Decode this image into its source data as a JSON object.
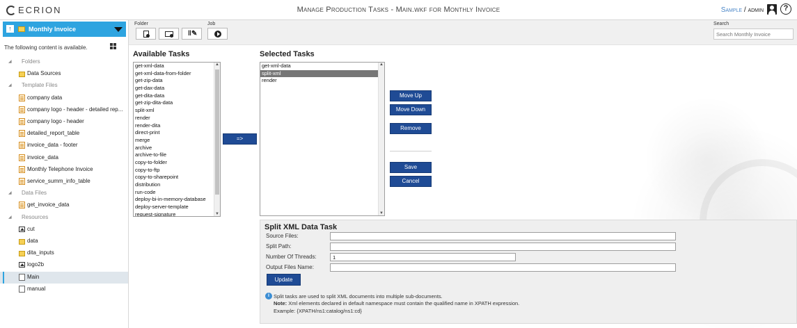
{
  "header": {
    "logo": "ECRION",
    "title": "Manage Production Tasks - Main.wkf for Monthly Invoice",
    "user_sample": "Sample",
    "user_separator": "/",
    "user_name": "admin",
    "help": "?"
  },
  "sidebar": {
    "project": "Monthly Invoice",
    "availability": "The following content is available.",
    "tree": [
      {
        "type": "section",
        "label": "Folders"
      },
      {
        "type": "folder",
        "label": "Data Sources"
      },
      {
        "type": "section",
        "label": "Template Files"
      },
      {
        "type": "template",
        "label": "company data"
      },
      {
        "type": "template",
        "label": "company logo - header - detailed rep..."
      },
      {
        "type": "template",
        "label": "company logo - header"
      },
      {
        "type": "template",
        "label": "detailed_report_table"
      },
      {
        "type": "template",
        "label": "invoice_data - footer"
      },
      {
        "type": "template",
        "label": "invoice_data"
      },
      {
        "type": "template",
        "label": "Monthly Telephone Invoice"
      },
      {
        "type": "template",
        "label": "service_summ_info_table"
      },
      {
        "type": "section",
        "label": "Data Files"
      },
      {
        "type": "template",
        "label": "get_invoice_data"
      },
      {
        "type": "section",
        "label": "Resources"
      },
      {
        "type": "image",
        "label": "cut"
      },
      {
        "type": "folder",
        "label": "data"
      },
      {
        "type": "folder",
        "label": "dita_inputs"
      },
      {
        "type": "image",
        "label": "logo2b"
      },
      {
        "type": "workflow",
        "label": "Main",
        "active": true
      },
      {
        "type": "doc",
        "label": "manual"
      }
    ]
  },
  "toolbar": {
    "folder_label": "Folder",
    "job_label": "Job",
    "search_label": "Search",
    "search_placeholder": "Search Monthly Invoice",
    "icons": [
      "new-file-icon",
      "folder-settings-icon",
      "tools-icon",
      "play-icon"
    ]
  },
  "available": {
    "heading": "Available Tasks",
    "items": [
      "get-xml-data",
      "get-xml-data-from-folder",
      "get-zip-data",
      "get-dax-data",
      "get-dita-data",
      "get-zip-dita-data",
      "split-xml",
      "render",
      "render-dita",
      "direct-print",
      "merge",
      "archive",
      "archive-to-file",
      "copy-to-folder",
      "copy-to-ftp",
      "copy-to-sharepoint",
      "distribution",
      "run-code",
      "deploy-bi-in-memory-database",
      "deploy-server-template",
      "request-signature"
    ]
  },
  "add_button": "=>",
  "selected": {
    "heading": "Selected Tasks",
    "items": [
      "get-xml-data",
      "split-xml",
      "render"
    ],
    "selected_item": "split-xml"
  },
  "buttons": {
    "move_up": "Move Up",
    "move_down": "Move Down",
    "remove": "Remove",
    "save": "Save",
    "cancel": "Cancel"
  },
  "task_panel": {
    "title": "Split XML Data Task",
    "fields": [
      {
        "label": "Source Files:",
        "value": ""
      },
      {
        "label": "Split Path:",
        "value": ""
      },
      {
        "label": "Number Of Threads:",
        "value": "1"
      },
      {
        "label": "Output Files Name:",
        "value": ""
      }
    ],
    "update": "Update",
    "info_line1": "Split tasks are used to split XML documents into multiple sub-documents.",
    "note_label": "Note:",
    "note_text": "Xml elements declared in default namespace must contain the qualified name in XPATH expression.",
    "example": "Example: {XPATH/ns1:catalog/ns1:cd}"
  },
  "colors": {
    "accent": "#2ea4e0",
    "button": "#1f4b95",
    "selection": "#767676"
  }
}
